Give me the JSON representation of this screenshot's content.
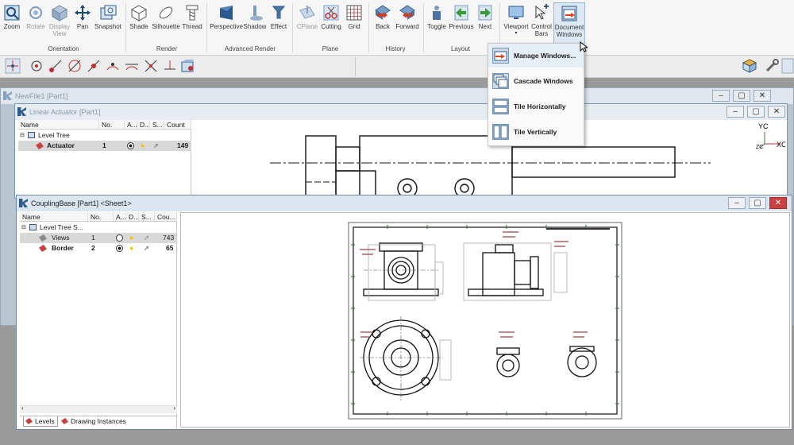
{
  "ribbon": {
    "orientation": {
      "group": "Orientation",
      "zoom": "Zoom",
      "rotate": "Rotate",
      "display_view": "Display View",
      "pan": "Pan",
      "snapshot": "Snapshot"
    },
    "render": {
      "group": "Render",
      "shade": "Shade",
      "silhouette": "Silhouette",
      "thread": "Thread"
    },
    "advanced": {
      "group": "Advanced Render",
      "perspective": "Perspective",
      "shadow": "Shadow",
      "effect": "Effect"
    },
    "plane": {
      "group": "Plane",
      "cplane": "CPlane",
      "cutting": "Cutting",
      "grid": "Grid"
    },
    "history": {
      "group": "History",
      "back": "Back",
      "forward": "Forward"
    },
    "layout": {
      "group": "Layout",
      "toggle": "Toggle",
      "previous": "Previous",
      "next": "Next",
      "viewport": "Viewport",
      "control_bars": "Control Bars",
      "document_windows": "Document Windows"
    }
  },
  "menu": {
    "items": [
      "Manage Windows...",
      "Cascade Windows",
      "Tile Horizontally",
      "Tile Vertically"
    ]
  },
  "windows": {
    "newfile": {
      "title": "NewFile1 [Part1]"
    },
    "actuator": {
      "title": "Linear Actuator [Part1]",
      "cols": [
        "Name",
        "No.",
        "A...",
        "D...",
        "S...",
        "Count"
      ],
      "rows": [
        {
          "name": "Level Tree",
          "no": "",
          "count": ""
        },
        {
          "name": "Actuator",
          "no": "1",
          "count": "149"
        }
      ]
    },
    "coupling": {
      "title": "CouplingBase [Part1] <Sheet1>",
      "cols": [
        "Name",
        "No.",
        "A...",
        "D...",
        "S...",
        "Cou..."
      ],
      "rows": [
        {
          "name": "Level Tree S...",
          "no": "",
          "count": ""
        },
        {
          "name": "Views",
          "no": "1",
          "count": "743"
        },
        {
          "name": "Border",
          "no": "2",
          "count": "65"
        }
      ],
      "tabs": [
        "Levels",
        "Drawing Instances"
      ]
    }
  },
  "axes": {
    "y": "YC",
    "x": "XC",
    "z": "ZC"
  },
  "colors": {
    "accent": "#2d5a8e",
    "selected": "#d8d8d8",
    "close": "#c84040",
    "lightbulb": "#f2c200"
  }
}
